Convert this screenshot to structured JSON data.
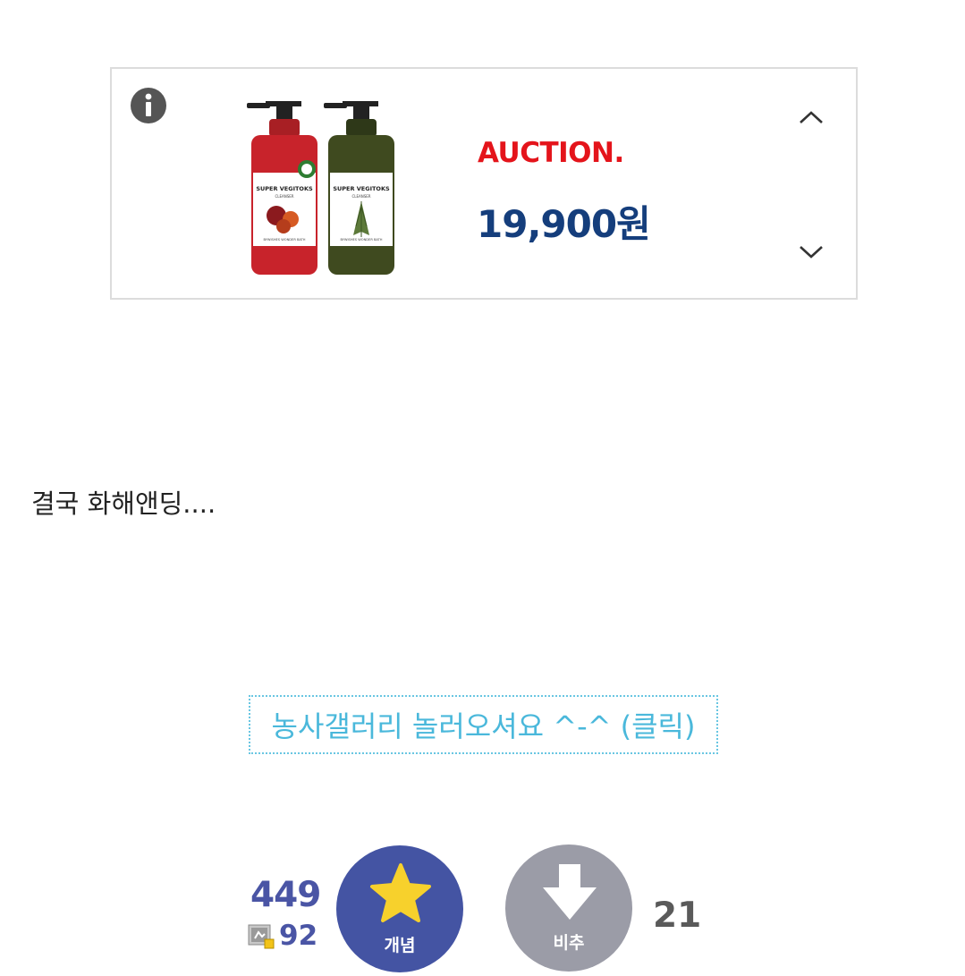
{
  "ad": {
    "store": "AUCTION.",
    "price": "19,900원",
    "product_label_1": "SUPER VEGITOKS",
    "product_label_2": "CLEANSER",
    "product_label_3": "BYWISHES WONDER BATH",
    "colors": {
      "store": "#e4141b",
      "price": "#153e7c",
      "bottle_red": "#c8232b",
      "bottle_green": "#3f4a1f"
    }
  },
  "post": {
    "text": "결국 화해앤딩...."
  },
  "gallery_link": {
    "text": "농사갤러리 놀러오셔요 ^-^ (클릭)"
  },
  "votes": {
    "up_count": "449",
    "fix_count": "92",
    "up_label": "개념",
    "down_label": "비추",
    "down_count": "21",
    "colors": {
      "up": "#4454a3",
      "down": "#9b9ca7",
      "star": "#f7d12c"
    }
  }
}
